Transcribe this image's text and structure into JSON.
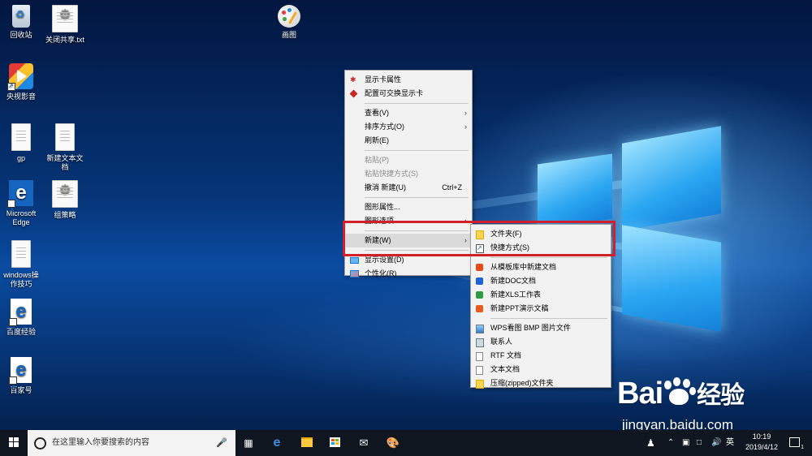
{
  "desktop": {
    "icons": [
      {
        "label": "回收站",
        "glyph": "recycle-bin-icon"
      },
      {
        "label": "关闭共享.txt",
        "glyph": "gear-file-icon"
      },
      {
        "label": "画图",
        "glyph": "paint-icon"
      },
      {
        "label": "央视影音",
        "glyph": "cctv-player-icon"
      },
      {
        "label": "gp",
        "glyph": "document-icon"
      },
      {
        "label": "新建文本文档",
        "glyph": "document-icon"
      },
      {
        "label": "Microsoft Edge",
        "glyph": "edge-icon"
      },
      {
        "label": "组策略",
        "glyph": "gear-file-icon"
      },
      {
        "label": "windows操作技巧",
        "glyph": "document-icon"
      },
      {
        "label": "百度经验",
        "glyph": "edge-icon"
      },
      {
        "label": "百家号",
        "glyph": "edge-icon"
      }
    ]
  },
  "context_menu": {
    "display_card_properties": "显示卡属性",
    "switchable_graphics": "配置可交换显示卡",
    "view": "查看(V)",
    "sort_by": "排序方式(O)",
    "refresh": "刷新(E)",
    "paste": "粘贴(P)",
    "paste_shortcut": "粘贴快捷方式(S)",
    "undo_new": "撤消 新建(U)",
    "undo_accel": "Ctrl+Z",
    "graphics_properties": "图形属性...",
    "graphics_options": "图形选项",
    "new": "新建(W)",
    "display_settings": "显示设置(D)",
    "personalize": "个性化(R)"
  },
  "submenu": {
    "folder": "文件夹(F)",
    "shortcut": "快捷方式(S)",
    "template": "从模板库中新建文档",
    "doc": "新建DOC文档",
    "xls": "新建XLS工作表",
    "ppt": "新建PPT演示文稿",
    "bmp": "WPS看图 BMP 图片文件",
    "contact": "联系人",
    "rtf": "RTF 文档",
    "text": "文本文档",
    "zip": "压缩(zipped)文件夹"
  },
  "taskbar": {
    "search_placeholder": "在这里输入你要搜索的内容",
    "ime": "英",
    "time": "10:19",
    "date": "2019/4/12",
    "notifications": "1"
  },
  "watermark": {
    "brand": "Bai",
    "brand_suffix": "经验",
    "url": "jingyan.baidu.com"
  },
  "colors": {
    "highlight_box": "#d1202c",
    "menu_bg": "#f2f2f2",
    "taskbar_bg": "#10161f"
  }
}
